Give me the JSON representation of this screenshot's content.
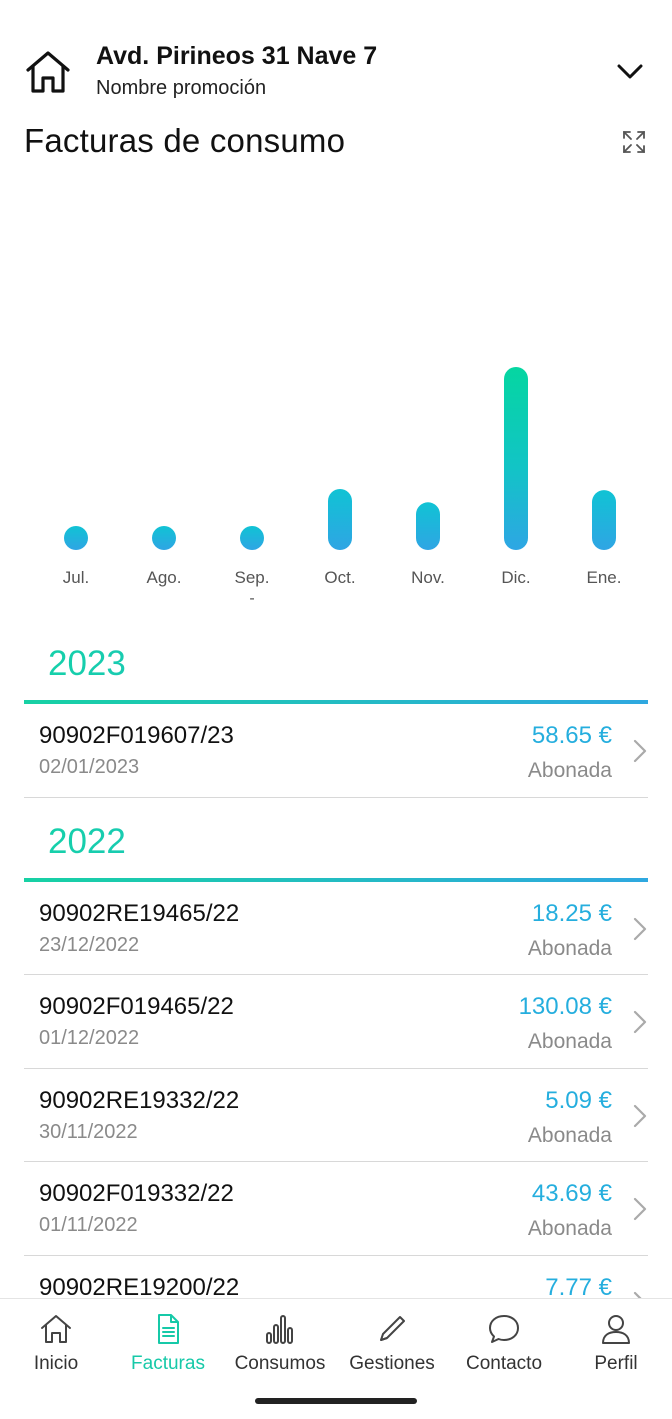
{
  "header": {
    "address": "Avd. Pirineos 31 Nave 7",
    "subtitle": "Nombre promoción"
  },
  "page_title": "Facturas de consumo",
  "chart_data": {
    "type": "bar",
    "title": "",
    "categories": [
      "Jul.",
      "Ago.",
      "Sep.",
      "Oct.",
      "Nov.",
      "Dic.",
      "Ene."
    ],
    "sublabels": [
      "",
      "",
      "-",
      "",
      "",
      "",
      ""
    ],
    "values": [
      0,
      15,
      11,
      55,
      43,
      165,
      54
    ],
    "highlight": "Dic.",
    "colors": {
      "bar_top_high": "#05d6a1",
      "bar_bottom": "#2ea6e4",
      "bar_mid": "#14c0d8"
    },
    "grid": false
  },
  "invoices": [
    {
      "year": "2023",
      "items": [
        {
          "number": "90902F019607/23",
          "date": "02/01/2023",
          "amount": "58.65 €",
          "status": "Abonada"
        }
      ]
    },
    {
      "year": "2022",
      "items": [
        {
          "number": "90902RE19465/22",
          "date": "23/12/2022",
          "amount": "18.25 €",
          "status": "Abonada"
        },
        {
          "number": "90902F019465/22",
          "date": "01/12/2022",
          "amount": "130.08 €",
          "status": "Abonada"
        },
        {
          "number": "90902RE19332/22",
          "date": "30/11/2022",
          "amount": "5.09 €",
          "status": "Abonada"
        },
        {
          "number": "90902F019332/22",
          "date": "01/11/2022",
          "amount": "43.69 €",
          "status": "Abonada"
        },
        {
          "number": "90902RE19200/22",
          "date": "",
          "amount": "7.77 €",
          "status": ""
        }
      ]
    }
  ],
  "tabs": [
    {
      "label": "Inicio",
      "icon": "home-icon",
      "active": false
    },
    {
      "label": "Facturas",
      "icon": "document-icon",
      "active": true
    },
    {
      "label": "Consumos",
      "icon": "bar-chart-icon",
      "active": false
    },
    {
      "label": "Gestiones",
      "icon": "pencil-icon",
      "active": false
    },
    {
      "label": "Contacto",
      "icon": "chat-bubble-icon",
      "active": false
    },
    {
      "label": "Perfil",
      "icon": "user-icon",
      "active": false
    }
  ],
  "colors": {
    "accent_green": "#16c9a8",
    "accent_blue": "#25aede",
    "muted_text": "#8a8a8a"
  }
}
